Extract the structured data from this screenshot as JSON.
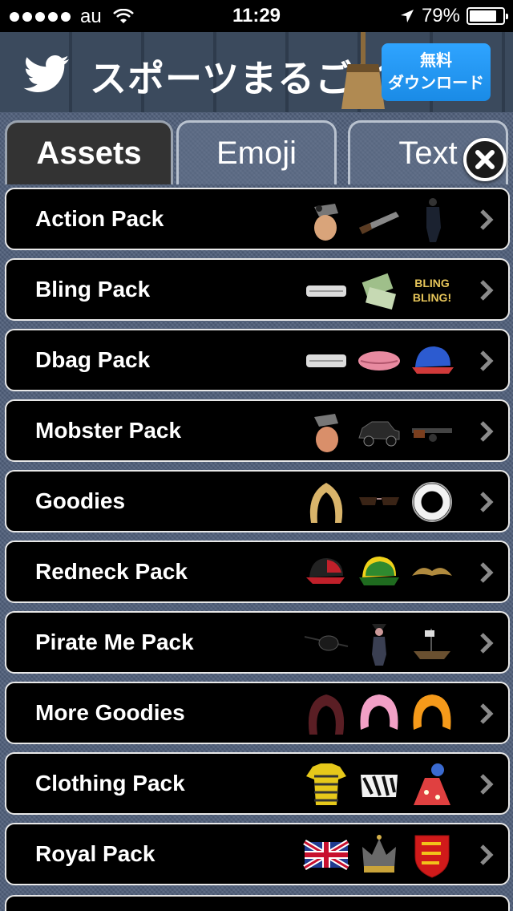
{
  "status_bar": {
    "carrier": "au",
    "time": "11:29",
    "battery": "79%",
    "signal_bars": 5
  },
  "ad": {
    "title": "スポーツまるごと",
    "cta_line1": "無料",
    "cta_line2": "ダウンロード",
    "icon": "twitter-icon",
    "accent": "#1a8be6"
  },
  "tabs": [
    {
      "label": "Assets",
      "active": true
    },
    {
      "label": "Emoji",
      "active": false
    },
    {
      "label": "Text",
      "active": false
    }
  ],
  "packs": [
    {
      "label": "Action Pack",
      "thumbs": [
        "gun-hand-icon",
        "shotgun-icon",
        "gangster-figure-icon"
      ]
    },
    {
      "label": "Bling Pack",
      "thumbs": [
        "grill-teeth-icon",
        "money-icon",
        "bling-text-icon"
      ]
    },
    {
      "label": "Dbag Pack",
      "thumbs": [
        "grill-teeth-icon",
        "lips-icon",
        "cap-icon"
      ]
    },
    {
      "label": "Mobster Pack",
      "thumbs": [
        "gun-hand-icon",
        "vintage-car-icon",
        "tommy-gun-icon"
      ]
    },
    {
      "label": "Goodies",
      "thumbs": [
        "blonde-wig-icon",
        "sunglasses-icon",
        "ring-icon"
      ]
    },
    {
      "label": "Redneck Pack",
      "thumbs": [
        "trucker-cap-icon",
        "green-cap-icon",
        "mustache-icon"
      ]
    },
    {
      "label": "Pirate Me Pack",
      "thumbs": [
        "eyepatch-icon",
        "pirate-figure-icon",
        "pirate-ship-icon"
      ]
    },
    {
      "label": "More Goodies",
      "thumbs": [
        "dark-wig-icon",
        "pink-wig-icon",
        "orange-wig-icon"
      ]
    },
    {
      "label": "Clothing Pack",
      "thumbs": [
        "striped-shirt-icon",
        "zebra-top-icon",
        "dress-icon"
      ]
    },
    {
      "label": "Royal Pack",
      "thumbs": [
        "union-jack-icon",
        "crown-icon",
        "royal-shield-icon"
      ]
    }
  ],
  "bling_text": "BLING BLING!"
}
